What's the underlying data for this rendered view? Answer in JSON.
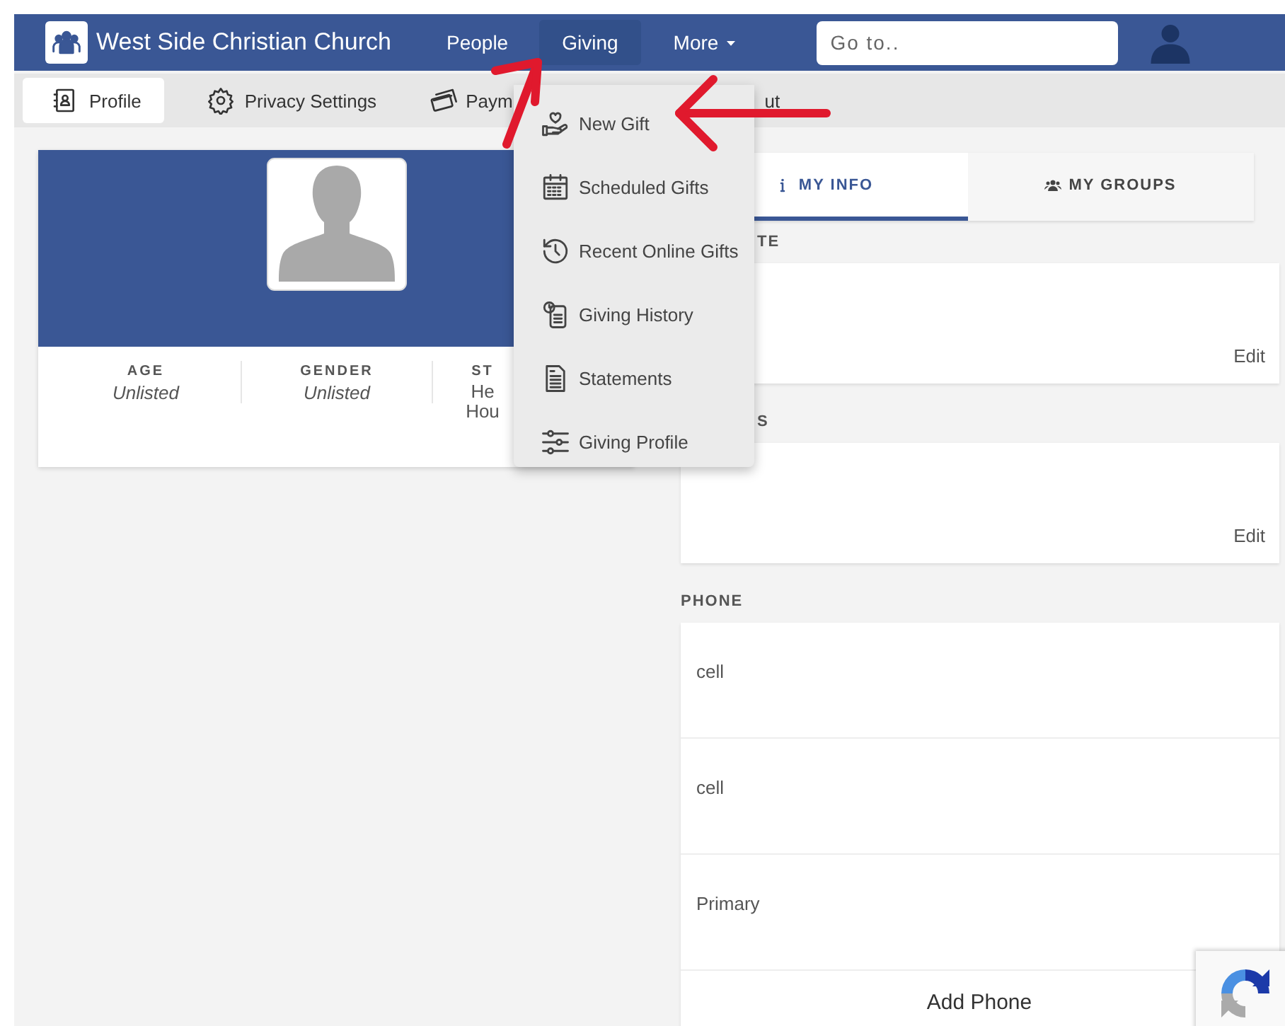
{
  "header": {
    "brand": "West Side Christian Church",
    "nav": [
      {
        "label": "People",
        "selected": false,
        "has_menu": false
      },
      {
        "label": "Giving",
        "selected": true,
        "has_menu": false
      },
      {
        "label": "More",
        "selected": false,
        "has_menu": true
      }
    ],
    "search": {
      "placeholder": "Go to.."
    }
  },
  "subnav": [
    {
      "label": "Profile",
      "selected": true
    },
    {
      "label": "Privacy Settings",
      "selected": false
    },
    {
      "label": "Paym",
      "selected": false
    },
    {
      "label": "ut",
      "selected": false
    }
  ],
  "giving_menu": [
    {
      "label": "New Gift"
    },
    {
      "label": "Scheduled Gifts"
    },
    {
      "label": "Recent Online Gifts"
    },
    {
      "label": "Giving History"
    },
    {
      "label": "Statements"
    },
    {
      "label": "Giving Profile"
    }
  ],
  "profile_card": {
    "stats": [
      {
        "label": "AGE",
        "value": "Unlisted"
      },
      {
        "label": "GENDER",
        "value": "Unlisted"
      },
      {
        "label": "ST",
        "value": "He Hou"
      }
    ]
  },
  "tabs": [
    {
      "label": "MY INFO",
      "selected": true
    },
    {
      "label": "MY GROUPS",
      "selected": false
    }
  ],
  "sections": [
    {
      "label": "TE",
      "action": "Edit"
    },
    {
      "label": "S",
      "action": "Edit"
    }
  ],
  "phone": {
    "label": "PHONE",
    "entries": [
      {
        "type": "cell"
      },
      {
        "type": "cell"
      },
      {
        "type": "Primary"
      }
    ],
    "add_button": "Add Phone"
  }
}
